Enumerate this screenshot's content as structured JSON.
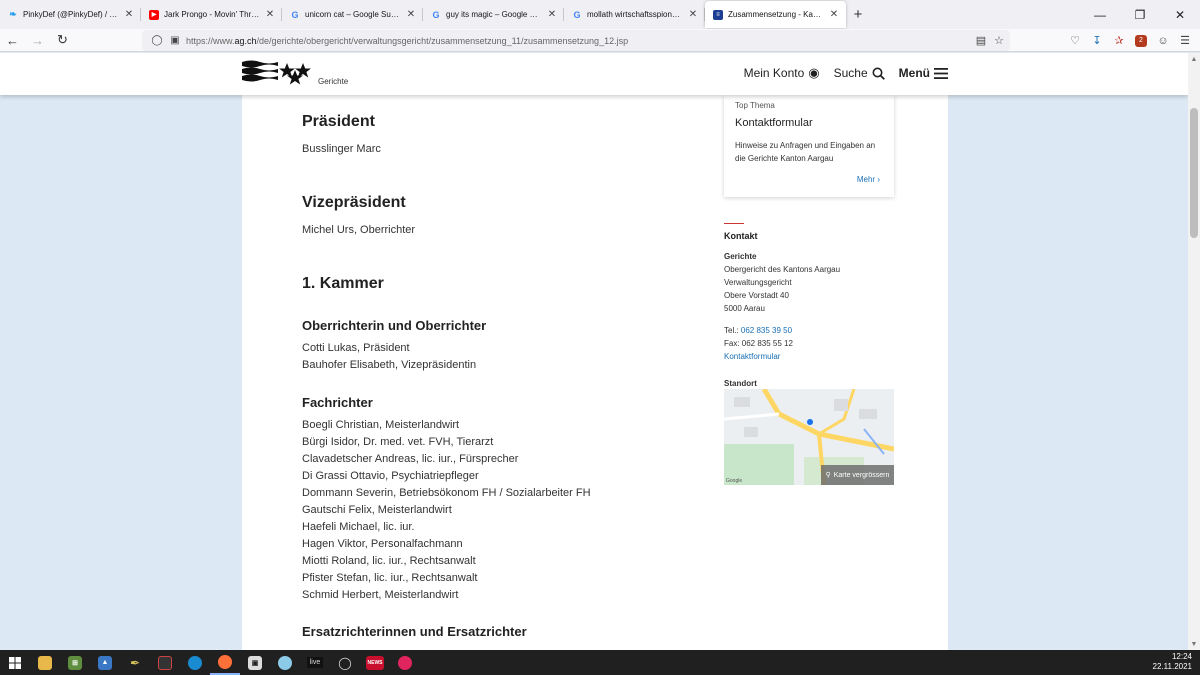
{
  "browser": {
    "tabs": [
      {
        "title": "PinkyDef (@PinkyDef) / Twitter",
        "icon": "twitter-icon",
        "color": "#1d9bf0"
      },
      {
        "title": "Jark Prongo - Movin' Thru Your",
        "icon": "youtube-icon",
        "color": "#ff0000"
      },
      {
        "title": "unicorn cat – Google Suche",
        "icon": "google-icon",
        "color": "#4285f4"
      },
      {
        "title": "guy its magic – Google Suche",
        "icon": "google-icon",
        "color": "#4285f4"
      },
      {
        "title": "mollath wirtschaftsspionage - G",
        "icon": "google-icon",
        "color": "#4285f4"
      },
      {
        "title": "Zusammensetzung - Kanton Aa",
        "icon": "aargau-flag-icon",
        "color": "#1c3f94",
        "active": true
      }
    ],
    "url_prefix": "https://www.",
    "url_host": "ag.ch",
    "url_path": "/de/gerichte/obergericht/verwaltungsgericht/zusammensetzung_11/zusammensetzung_12.jsp"
  },
  "header": {
    "logo_sub": "Gerichte",
    "mein_konto": "Mein Konto",
    "suche": "Suche",
    "menu": "Menü"
  },
  "content": {
    "praesident_heading": "Präsident",
    "praesident_name": "Busslinger Marc",
    "vize_heading": "Vizepräsident",
    "vize_name": "Michel Urs, Oberrichter",
    "kammer_heading": "1. Kammer",
    "oberrichter_heading": "Oberrichterin und Oberrichter",
    "oberrichter": [
      "Cotti Lukas, Präsident",
      "Bauhofer Elisabeth, Vizepräsidentin"
    ],
    "fachrichter_heading": "Fachrichter",
    "fachrichter": [
      "Boegli Christian, Meisterlandwirt",
      "Bürgi Isidor, Dr. med. vet. FVH, Tierarzt",
      "Clavadetscher Andreas, lic. iur., Fürsprecher",
      "Di Grassi Ottavio, Psychiatriepfleger",
      "Dommann Severin, Betriebsökonom FH / Sozialarbeiter FH",
      "Gautschi Felix, Meisterlandwirt",
      "Haefeli Michael, lic. iur.",
      "Hagen Viktor, Personalfachmann",
      "Miotti Roland, lic. iur., Rechtsanwalt",
      "Pfister Stefan, lic. iur., Rechtsanwalt",
      "Schmid Herbert, Meisterlandwirt"
    ],
    "ersatz_heading": "Ersatzrichterinnen und Ersatzrichter"
  },
  "sidebar": {
    "top_label": "Top Thema",
    "top_title": "Kontaktformular",
    "top_desc": "Hinweise zu Anfragen und Eingaben an die Gerichte Kanton Aargau",
    "top_more": "Mehr",
    "kontakt_heading": "Kontakt",
    "org": "Gerichte",
    "address": [
      "Obergericht des Kantons Aargau",
      "Verwaltungsgericht",
      "Obere Vorstadt 40",
      "5000 Aarau"
    ],
    "tel_label": "Tel.:",
    "tel": "062 835 39 50",
    "fax": "Fax: 062 835 55 12",
    "kontaktformular": "Kontaktformular",
    "standort_heading": "Standort",
    "map_button": "Karte vergrössern",
    "map_google": "Google"
  },
  "taskbar": {
    "time": "12:24",
    "date": "22.11.2021",
    "live_label": "live",
    "news_label": "NEWS"
  },
  "colors": {
    "link": "#1a6fb5",
    "page_bg": "#dce8f3",
    "accent_red": "#cc3333"
  }
}
